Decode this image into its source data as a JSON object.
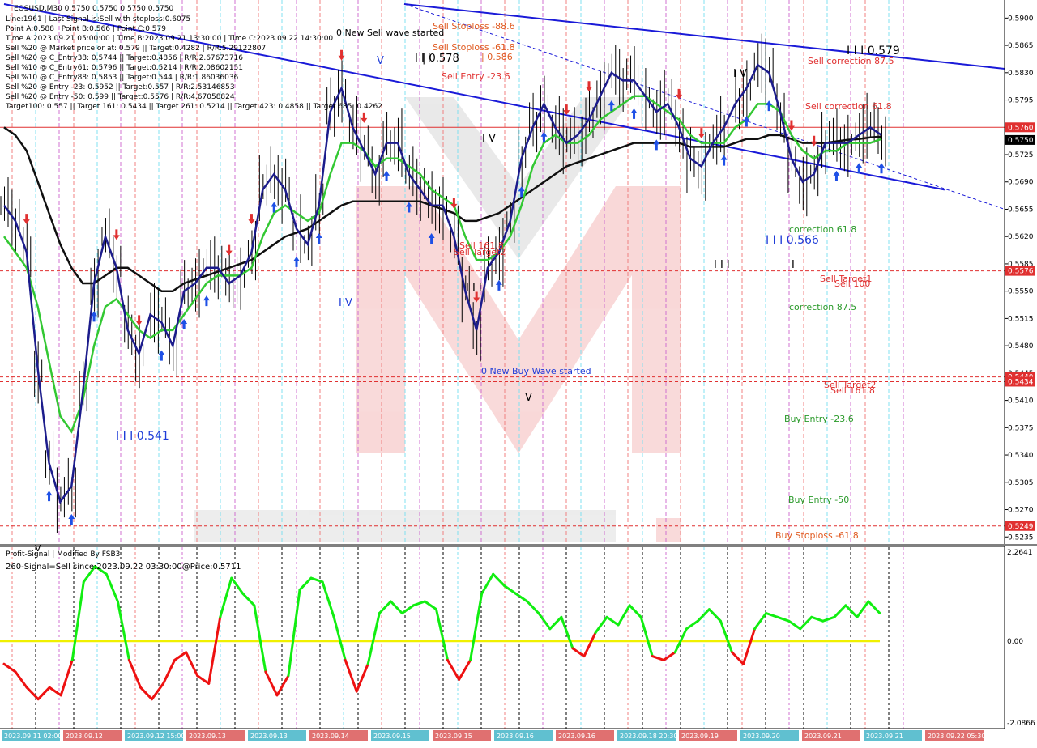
{
  "header": {
    "title_line": "EOSUSD,M30  0.5750 0.5750 0.5750 0.5750",
    "info_lines": [
      "Line:1961 | Last Signal is:Sell with stoploss:0.6075",
      "Point A:0.588 | Point B:0.566 | Point C:0.579",
      "Time A:2023.09.21 05:00:00 | Time B:2023.09.21 13:30:00 | Time C:2023.09.22 14:30:00",
      "Sell %20 @ Market price or at: 0.579 || Target:0.4282 | R/R:5.29122807",
      "Sell %20 @ C_Entry38: 0.5744 || Target:0.4856 | R/R:2.67673716",
      "Sell %10 @ C_Entry61: 0.5796 || Target:0.5214 | R/R:2.08602151",
      "Sell %10 @ C_Entry88: 0.5853 || Target:0.544 | R/R:1.86036036",
      "Sell %20 @ Entry -23: 0.5952 || Target:0.557 | R/R:2.53146853",
      "Sell %20 @ Entry -50: 0.599 || Target:0.5576 | R/R:4.67058824",
      "Target100: 0.557 || Target 161: 0.5434 || Target 261: 0.5214 || Target 423: 0.4858 || Target 685: 0.4262"
    ]
  },
  "price_axis": {
    "labels": [
      "0.5900",
      "0.5865",
      "0.5830",
      "0.5795",
      "0.5760",
      "0.5725",
      "0.5690",
      "0.5655",
      "0.5620",
      "0.5585",
      "0.5550",
      "0.5515",
      "0.5480",
      "0.5445",
      "0.5410",
      "0.5375",
      "0.5340",
      "0.5305",
      "0.5270",
      "0.5235"
    ],
    "current_price": "0.5750",
    "level_tags": [
      "0.5760",
      "0.5576",
      "0.5440",
      "0.5434",
      "0.5249"
    ]
  },
  "chart_labels": [
    "0 New Sell wave started",
    "0 New Buy Wave started",
    "Sell Stoploss -88.6",
    "Sell Stoploss -61.8",
    "| 0.578",
    "| 0.586",
    "Sell Entry -23.6",
    "Sell 161.8",
    "Sell Target2",
    "I I I 0.579",
    "I I I 0.566",
    "I I I 0.541",
    "Sell correction 87.5",
    "Sell correction 61.8",
    "correction 61.8",
    "correction 87.5",
    "Sell Target1",
    "Sell 100",
    "Sell Target2",
    "Sell 161.8",
    "Buy Entry -23.6",
    "Buy Entry -50",
    "Buy Stoploss -61.8",
    "V",
    "I V",
    "I V",
    "V",
    "I V",
    "I I I",
    "I I I",
    "I",
    "I I I",
    "V"
  ],
  "indicator": {
    "title": "Profit-Signal | Modified By FSB3",
    "signal_text": "260-Signal=Sell since:2023.09.22 03:30:00@Price:0.5711",
    "axis_labels": [
      "2.2641",
      "0.00",
      "-2.0866"
    ]
  },
  "time_axis": {
    "labels": [
      "2023.09.11 02:00",
      "2023.09.12",
      "2023.09.12 15:00",
      "2023.09.13",
      "2023.09.13",
      "2023.09.14",
      "2023.09.15",
      "2023.09.15",
      "2023.09.16",
      "2023.09.16",
      "2023.09.18 20:30",
      "2023.09.19",
      "2023.09.20",
      "2023.09.21",
      "2023.09.21",
      "2023.09.22 05:30"
    ]
  },
  "colors": {
    "sell_accent": "#e03030",
    "buy_accent": "#1e50e6",
    "trend_line": "#1a1ad8",
    "ma_fast": "#1c1c8c",
    "ma_mid": "#33c833",
    "ma_slow": "#101010",
    "indicator_up": "#11ee11",
    "indicator_down": "#ee1111",
    "indicator_zero": "#f0f000"
  },
  "chart_data": {
    "type": "line",
    "symbol": "EOSUSD",
    "timeframe": "M30",
    "ylim": [
      0.5228,
      0.5918
    ],
    "series": [
      {
        "values": [
          0.566,
          0.564,
          0.56,
          0.545,
          0.533,
          0.528,
          0.53,
          0.542,
          0.556,
          0.562,
          0.558,
          0.55,
          0.547,
          0.552,
          0.551,
          0.548,
          0.555,
          0.556,
          0.558,
          0.558,
          0.556,
          0.557,
          0.56,
          0.568,
          0.57,
          0.568,
          0.563,
          0.561,
          0.566,
          0.578,
          0.581,
          0.576,
          0.573,
          0.57,
          0.574,
          0.574,
          0.57,
          0.568,
          0.566,
          0.566,
          0.562,
          0.555,
          0.55,
          0.558,
          0.56,
          0.564,
          0.572,
          0.576,
          0.579,
          0.576,
          0.574,
          0.575,
          0.577,
          0.58,
          0.583,
          0.582,
          0.582,
          0.58,
          0.578,
          0.579,
          0.576,
          0.572,
          0.571,
          0.574,
          0.576,
          0.579,
          0.581,
          0.584,
          0.583,
          0.578,
          0.572,
          0.569,
          0.57,
          0.574,
          0.574,
          0.574,
          0.575,
          0.576,
          0.575
        ]
      },
      {
        "values": [
          0.562,
          0.56,
          0.558,
          0.553,
          0.546,
          0.539,
          0.537,
          0.541,
          0.548,
          0.553,
          0.554,
          0.552,
          0.55,
          0.549,
          0.55,
          0.55,
          0.552,
          0.554,
          0.556,
          0.557,
          0.557,
          0.557,
          0.558,
          0.562,
          0.565,
          0.566,
          0.565,
          0.564,
          0.565,
          0.57,
          0.574,
          0.574,
          0.573,
          0.571,
          0.572,
          0.572,
          0.571,
          0.57,
          0.568,
          0.567,
          0.566,
          0.562,
          0.559,
          0.559,
          0.56,
          0.562,
          0.566,
          0.571,
          0.574,
          0.575,
          0.574,
          0.574,
          0.575,
          0.577,
          0.578,
          0.579,
          0.58,
          0.58,
          0.579,
          0.578,
          0.577,
          0.575,
          0.574,
          0.574,
          0.574,
          0.576,
          0.577,
          0.579,
          0.579,
          0.578,
          0.575,
          0.573,
          0.572,
          0.573,
          0.573,
          0.574,
          0.574,
          0.574,
          0.5745
        ]
      },
      {
        "values": [
          0.576,
          0.575,
          0.573,
          0.569,
          0.565,
          0.561,
          0.558,
          0.556,
          0.556,
          0.557,
          0.558,
          0.558,
          0.557,
          0.556,
          0.555,
          0.555,
          0.556,
          0.5565,
          0.557,
          0.5575,
          0.558,
          0.5585,
          0.559,
          0.56,
          0.561,
          0.562,
          0.5625,
          0.563,
          0.564,
          0.565,
          0.566,
          0.5665,
          0.5665,
          0.5665,
          0.5665,
          0.5665,
          0.5665,
          0.5665,
          0.566,
          0.5655,
          0.565,
          0.564,
          0.564,
          0.5645,
          0.565,
          0.566,
          0.567,
          0.568,
          0.569,
          0.57,
          0.571,
          0.5715,
          0.572,
          0.5725,
          0.573,
          0.5735,
          0.574,
          0.574,
          0.574,
          0.574,
          0.574,
          0.5735,
          0.5735,
          0.5735,
          0.5735,
          0.574,
          0.5745,
          0.5745,
          0.575,
          0.575,
          0.5745,
          0.574,
          0.574,
          0.574,
          0.5742,
          0.5744,
          0.5745,
          0.5747,
          0.5748
        ]
      }
    ],
    "trendlines": [
      {
        "from": [
          0.0,
          0.5918
        ],
        "to": [
          0.94,
          0.568
        ]
      },
      {
        "from": [
          0.4,
          0.5918
        ],
        "to": [
          1.0,
          0.5835
        ]
      },
      {
        "from": [
          0.4,
          0.5918
        ],
        "to": [
          1.0,
          0.5655
        ]
      }
    ],
    "levels": [
      0.576,
      0.5576,
      0.544,
      0.5434,
      0.5249
    ],
    "indicator_series": {
      "ylim": [
        -2.0866,
        2.2641
      ],
      "values": [
        -0.6,
        -0.8,
        -1.2,
        -1.5,
        -1.2,
        -1.4,
        -0.5,
        1.5,
        1.9,
        1.7,
        1.0,
        -0.5,
        -1.2,
        -1.5,
        -1.1,
        -0.5,
        -0.3,
        -0.9,
        -1.1,
        0.6,
        1.6,
        1.2,
        0.9,
        -0.8,
        -1.4,
        -0.9,
        1.3,
        1.6,
        1.5,
        0.6,
        -0.5,
        -1.3,
        -0.6,
        0.7,
        1.0,
        0.7,
        0.9,
        1.0,
        0.8,
        -0.5,
        -1.0,
        -0.5,
        1.2,
        1.7,
        1.4,
        1.2,
        1.0,
        0.7,
        0.3,
        0.6,
        -0.2,
        -0.4,
        0.2,
        0.6,
        0.4,
        0.9,
        0.6,
        -0.4,
        -0.5,
        -0.3,
        0.3,
        0.5,
        0.8,
        0.5,
        -0.3,
        -0.6,
        0.3,
        0.7,
        0.6,
        0.5,
        0.3,
        0.6,
        0.5,
        0.6,
        0.9,
        0.6,
        1.0,
        0.7
      ]
    }
  }
}
